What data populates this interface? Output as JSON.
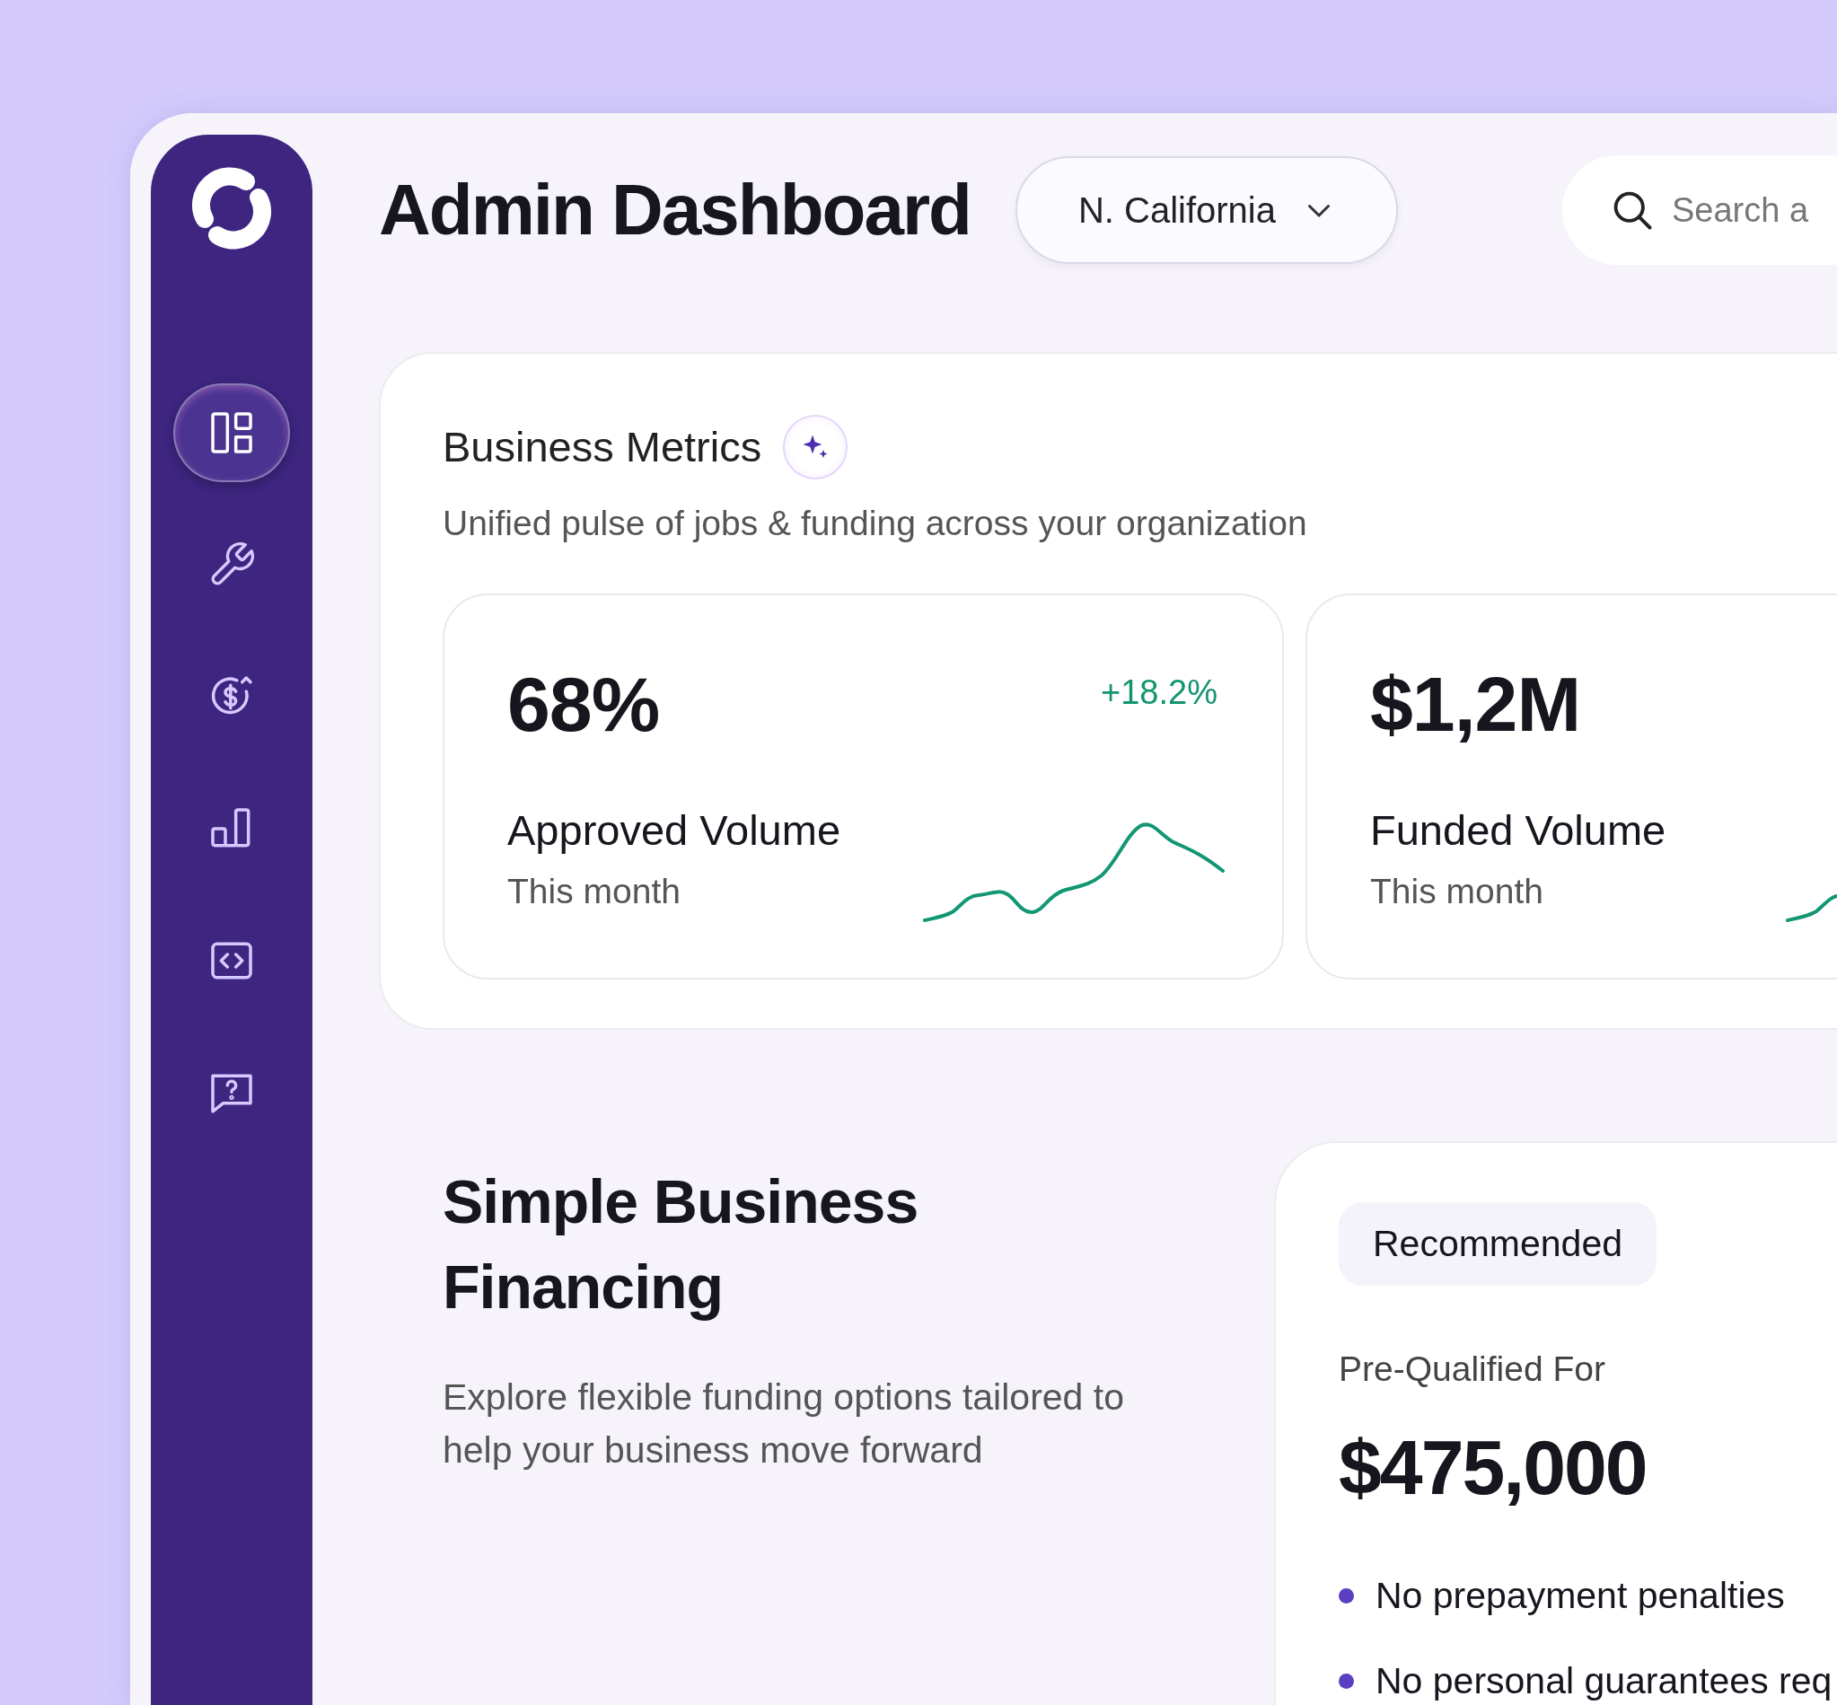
{
  "sidebar": {
    "items": [
      {
        "selected": true
      },
      {
        "selected": false
      },
      {
        "selected": false
      },
      {
        "selected": false
      },
      {
        "selected": false
      },
      {
        "selected": false
      }
    ]
  },
  "header": {
    "title": "Admin Dashboard",
    "region_dropdown": {
      "value": "N. California"
    },
    "search": {
      "placeholder": "Search a"
    }
  },
  "business_metrics": {
    "title": "Business Metrics",
    "subtitle": "Unified pulse of jobs & funding across your organization",
    "metrics": [
      {
        "value": "68%",
        "change": "+18.2%",
        "label": "Approved Volume",
        "period": "This month"
      },
      {
        "value": "$1,2M",
        "label": "Funded Volume",
        "period": "This month"
      }
    ]
  },
  "financing": {
    "title": "Simple Business Financing",
    "description": "Explore flexible funding options tailored to help your business move forward",
    "offer": {
      "badge": "Recommended",
      "label": "Pre-Qualified For",
      "amount": "$475,000",
      "features": [
        "No prepayment penalties",
        "No personal guarantees req"
      ]
    }
  }
}
